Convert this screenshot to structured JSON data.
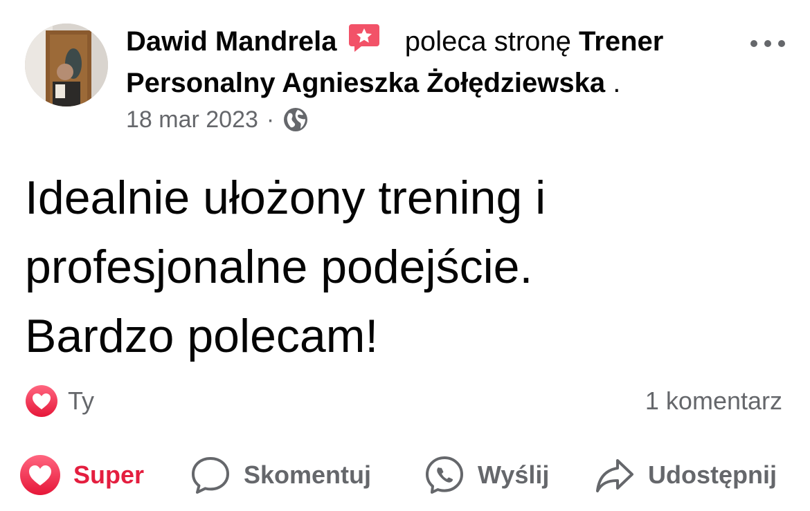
{
  "post": {
    "author": "Dawid Mandrela",
    "recommends_text": "poleca stronę",
    "page_name": "Trener Personalny Agnieszka Żołędziewska",
    "page_suffix": ".",
    "date": "18 mar 2023",
    "separator": "·",
    "privacy_icon": "globe-icon",
    "more_icon": "more-dots-icon",
    "body_lines": [
      "Idealnie ułożony trening i",
      "profesjonalne podejście.",
      "Bardzo polecam!"
    ]
  },
  "reactions": {
    "icon": "heart-icon",
    "who": "Ty",
    "comments": "1 komentarz"
  },
  "actions": {
    "super": {
      "label": "Super",
      "icon": "heart-icon",
      "active": true
    },
    "comment": {
      "label": "Skomentuj",
      "icon": "comment-bubble-icon"
    },
    "send": {
      "label": "Wyślij",
      "icon": "messenger-icon"
    },
    "share": {
      "label": "Udostępnij",
      "icon": "share-arrow-icon"
    }
  },
  "colors": {
    "text": "#050505",
    "secondary": "#65676b",
    "love_red": "#e41e3f",
    "badge_red": "#f25268"
  }
}
